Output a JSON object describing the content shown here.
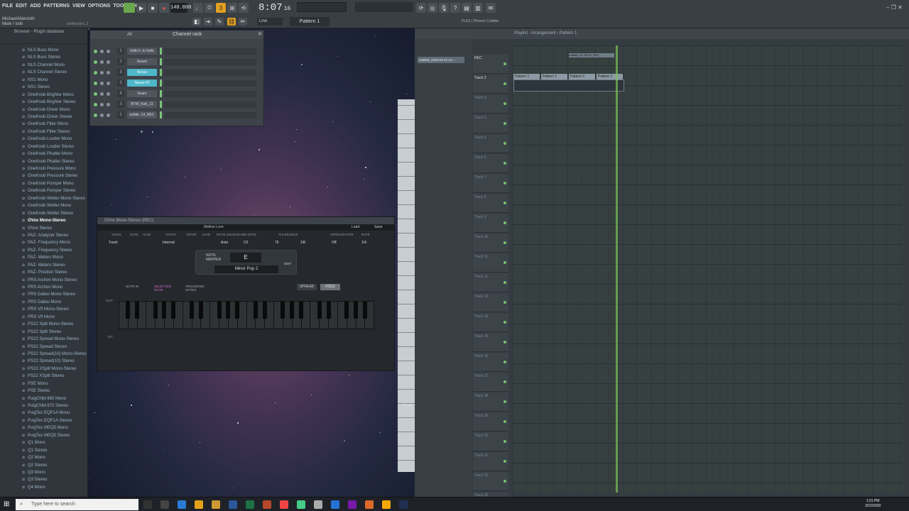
{
  "menu": [
    "FILE",
    "EDIT",
    "ADD",
    "PATTERNS",
    "VIEW",
    "OPTIONS",
    "TOOLS",
    "HELP"
  ],
  "tempo": "140.000",
  "clock": "8:07",
  "clock_sub": "16",
  "hint_user": "MichaelAfaircloth",
  "hint_text": "Mute / solo",
  "hint_key": "(shift/ctrl)+L.3",
  "pattern_label": "Pattern 1",
  "snap_label": "Line",
  "flex_label": "FLEX | Phonon Collider",
  "browser_title": "Browser - Plugin database",
  "browser_items": [
    "NLS Buss Mono",
    "NLS Buss Stereo",
    "NLS Channel Mono",
    "NLS Channel Stereo",
    "NS1 Mono",
    "NS1 Stereo",
    "OneKnob Brighter Mono",
    "OneKnob Brighter Stereo",
    "OneKnob Driver Mono",
    "OneKnob Driver Stereo",
    "OneKnob Filter Mono",
    "OneKnob Filter Stereo",
    "OneKnob Louder Mono",
    "OneKnob Louder Stereo",
    "OneKnob Phatter Mono",
    "OneKnob Phatter Stereo",
    "OneKnob Pressure Mono",
    "OneKnob Pressure Stereo",
    "OneKnob Pumper Mono",
    "OneKnob Pumper Stereo",
    "OneKnob Wetter Mono-Stereo",
    "OneKnob Wetter Mono",
    "OneKnob Wetter Stereo",
    "OVox Mono-Stereo",
    "OVox Stereo",
    "PAZ- Analyzer Stereo",
    "PAZ- Frequency Mono",
    "PAZ- Frequency Stereo",
    "PAZ- Meters Mono",
    "PAZ- Meters Stereo",
    "PAZ- Position Stereo",
    "PRS Archon Mono-Stereo",
    "PRS Archon Mono",
    "PRS Dallas Mono-Stereo",
    "PRS Dallas Mono",
    "PRS V9 Mono-Stereo",
    "PRS V9 Mono",
    "PS22 Split Mono-Stereo",
    "PS22 Split Stereo",
    "PS22 Spread Mono-Stereo",
    "PS22 Spread Stereo",
    "PS22 Spread(10) Mono-Stereo",
    "PS22 Spread(10) Stereo",
    "PS22 XSplit Mono-Stereo",
    "PS22 XSplit Stereo",
    "PSE Mono",
    "PSE Stereo",
    "PuigChild 660 Mono",
    "PuigChild 670 Stereo",
    "PuigTec EQP1A Mono",
    "PuigTec EQP1A Stereo",
    "PuigTec MEQ5 Mono",
    "PuigTec MEQ5 Stereo",
    "Q1 Mono",
    "Q1 Stereo",
    "Q2 Mono",
    "Q2 Stereo",
    "Q3 Mono",
    "Q3 Stereo",
    "Q4 Mono"
  ],
  "channel_rack": {
    "title": "Channel rack",
    "filter": "All",
    "channels": [
      {
        "num": "1",
        "name": "hello h..lo hello"
      },
      {
        "num": "2",
        "name": "Serum"
      },
      {
        "num": "3",
        "name": "Nexus"
      },
      {
        "num": "3",
        "name": "Nexus #2"
      },
      {
        "num": "4",
        "name": "Snare"
      },
      {
        "num": "3",
        "name": "BTW_Kick_11"
      },
      {
        "num": "1",
        "name": "untitle..14_REC"
      }
    ]
  },
  "ovox": {
    "title": "OVox Mono-Stereo (REC)",
    "preset": "Mellow Love",
    "load": "Load",
    "save": "Save",
    "labels": [
      "VOICE",
      "GATE",
      "GAIN",
      "SYNTH",
      "DRIVE",
      "GAIN",
      "NOTE SOURCE",
      "MIN NOTE",
      "TOLERANCE",
      "ARPEGGIATOR",
      "RATE"
    ],
    "voice_val": "Trash",
    "synth_val": "Internal",
    "source_val": "Auto",
    "minnote_val": "C0",
    "cents": "CENTS",
    "cents_val": "75",
    "time": "TIME",
    "time_val": "1/8",
    "arp_val": "Off",
    "rate_val": "1/4",
    "note_mapper": "NOTE MAPPER",
    "key": "E",
    "edit": "EDIT",
    "scale": "Minor Pop 2",
    "legend_in": "NOTE IN",
    "legend_sel": "SELECTED NOTE",
    "legend_trig": "TRIGGERED NOTES",
    "spread": "SPREAD",
    "fold": "FOLD",
    "map": "MAP",
    "vel": "VEL"
  },
  "strip_label": "Cont",
  "playlist": {
    "title": "Playlist - Arrangement › Pattern 1",
    "recent": "untitled_2020-03-22 12-...",
    "rec_clip": "untitled_20..53-14_REC",
    "tracks": [
      "REC",
      "Track 2",
      "Track 3",
      "Track 4",
      "Track 5",
      "Track 6",
      "Track 7",
      "Track 8",
      "Track 9",
      "Track 10",
      "Track 11",
      "Track 12",
      "Track 13",
      "Track 14",
      "Track 15",
      "Track 16",
      "Track 17",
      "Track 18",
      "Track 19",
      "Track 20",
      "Track 21",
      "Track 22",
      "Track 23"
    ],
    "ruler": [
      "2",
      "3",
      "4",
      "5",
      "6",
      "7",
      "8",
      "9",
      "10",
      "11",
      "13",
      "15",
      "17",
      "19",
      "21",
      "23",
      "25",
      "27"
    ],
    "clips": [
      "Pattern 1",
      "Pattern 1",
      "Pattern 1",
      "Pattern 1"
    ]
  },
  "taskbar": {
    "search": "Type here to search",
    "time": "1:01 PM",
    "date": "3/22/2020"
  }
}
